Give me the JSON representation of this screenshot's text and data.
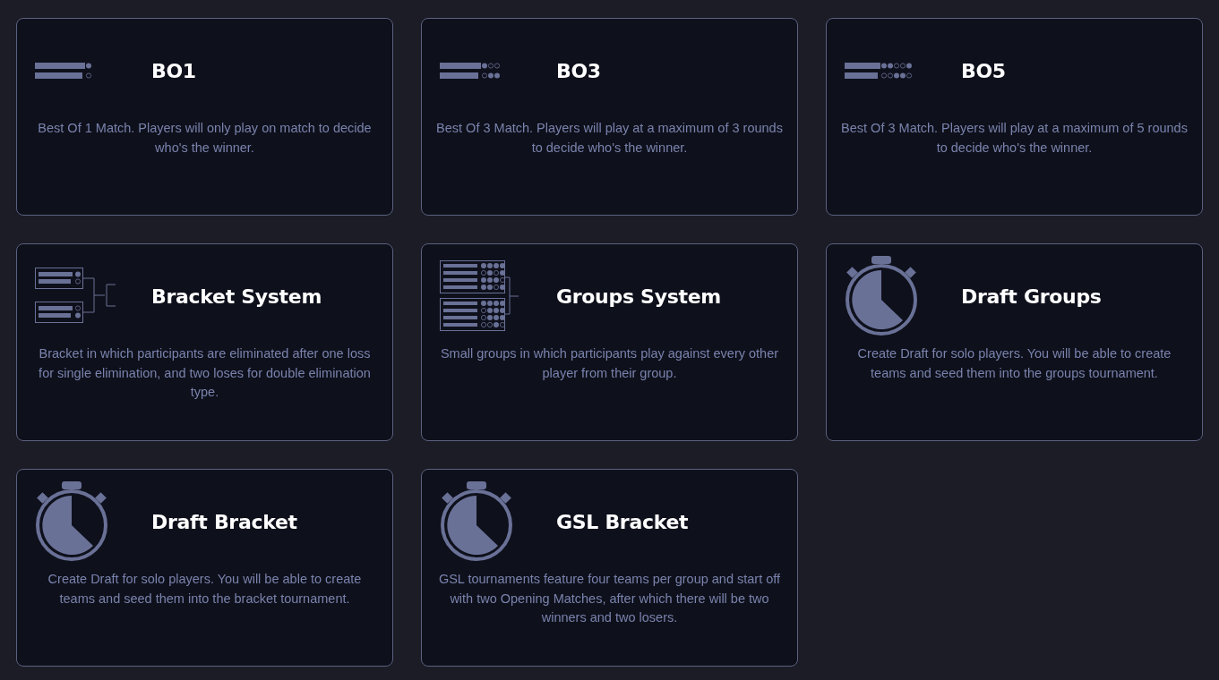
{
  "cards": [
    {
      "kind": "bo1",
      "title": "BO1",
      "description": "Best Of 1 Match. Players will only play on match to decide who's the winner."
    },
    {
      "kind": "bo3",
      "title": "BO3",
      "description": "Best Of 3 Match. Players will play at a maximum of 3 rounds to decide who's the winner."
    },
    {
      "kind": "bo5",
      "title": "BO5",
      "description": "Best Of 3 Match. Players will play at a maximum of 5 rounds to decide who's the winner."
    },
    {
      "kind": "bracket",
      "title": "Bracket System",
      "description": "Bracket in which participants are eliminated after one loss for single elimination, and two loses for double elimination type."
    },
    {
      "kind": "groups",
      "title": "Groups System",
      "description": "Small groups in which participants play against every other player from their group."
    },
    {
      "kind": "timer",
      "title": "Draft Groups",
      "description": "Create Draft for solo players. You will be able to create teams and seed them into the groups tournament."
    },
    {
      "kind": "timer",
      "title": "Draft Bracket",
      "description": "Create Draft for solo players. You will be able to create teams and seed them into the bracket tournament."
    },
    {
      "kind": "timer",
      "title": "GSL Bracket",
      "description": "GSL tournaments feature four teams per group and start off with two Opening Matches, after which there will be two winners and two losers."
    }
  ]
}
